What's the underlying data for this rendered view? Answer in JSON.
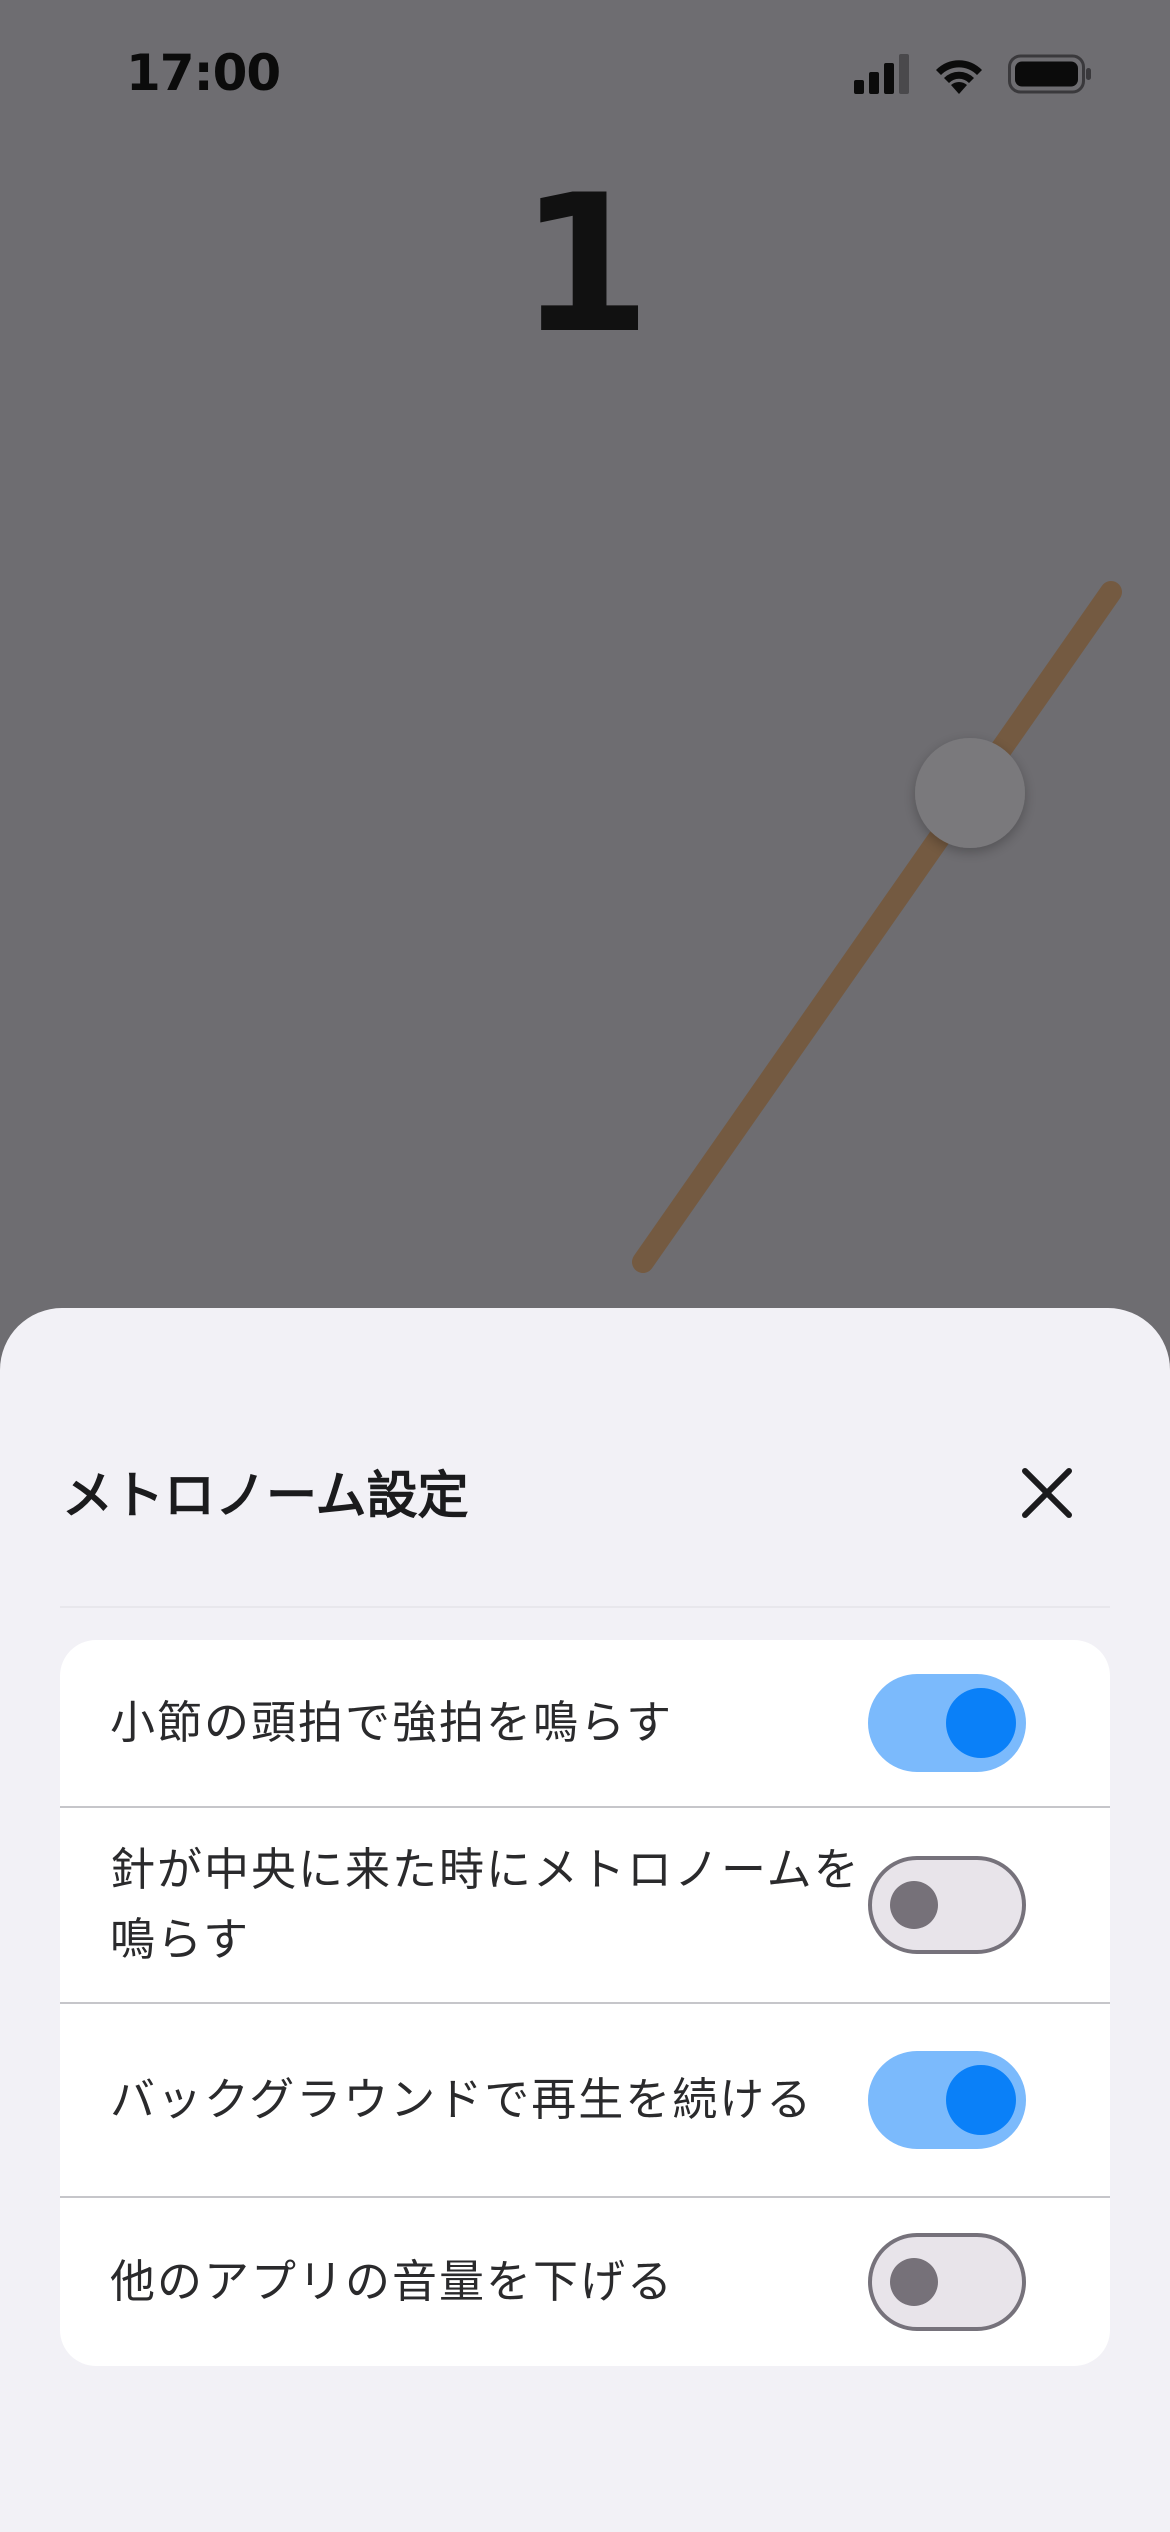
{
  "status_bar": {
    "time": "17:00",
    "icons": [
      "cellular-signal-icon",
      "wifi-icon",
      "battery-icon"
    ]
  },
  "metronome": {
    "beat": "1",
    "colors": {
      "rod": "#745a41",
      "pivot": "#7a797c"
    }
  },
  "sheet": {
    "title": "メトロノーム設定",
    "close_icon": "close-icon",
    "settings": [
      {
        "label": "小節の頭拍で強拍を鳴らす",
        "enabled": true
      },
      {
        "label": "針が中央に来た時にメトロノームを鳴らす",
        "enabled": false
      },
      {
        "label": "バックグラウンドで再生を続ける",
        "enabled": true
      },
      {
        "label": "他のアプリの音量を下げる",
        "enabled": false
      }
    ]
  },
  "colors": {
    "toggle_on_track": "#7bbafc",
    "toggle_on_knob": "#0a80f8",
    "toggle_off_track": "#e8e4ea",
    "toggle_off_knob": "#767179"
  }
}
